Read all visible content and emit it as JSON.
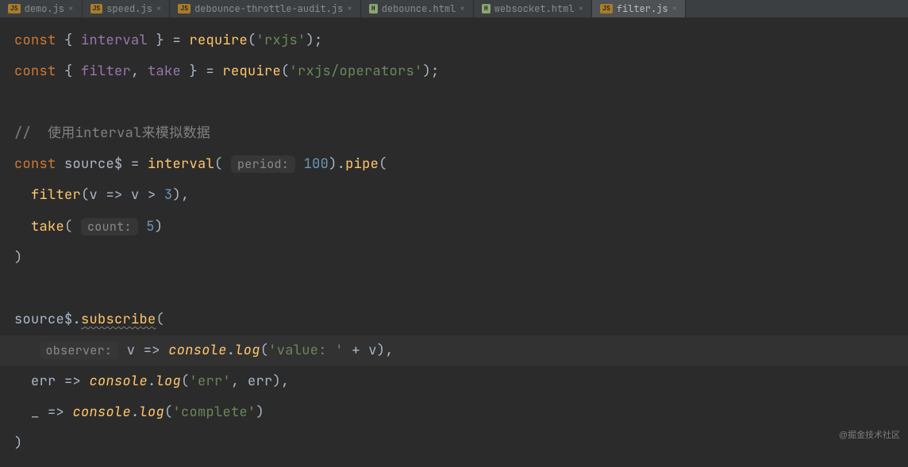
{
  "tabs": [
    {
      "type": "js",
      "label": "demo.js"
    },
    {
      "type": "js",
      "label": "speed.js"
    },
    {
      "type": "js",
      "label": "debounce-throttle-audit.js"
    },
    {
      "type": "html",
      "label": "debounce.html"
    },
    {
      "type": "html",
      "label": "websocket.html"
    },
    {
      "type": "js",
      "label": "filter.js",
      "active": true
    }
  ],
  "badges": {
    "js": "JS",
    "html": "H"
  },
  "watermark": "@掘金技术社区",
  "code": {
    "l1": {
      "kw_const": "const",
      "brace_o": "{ ",
      "id_interval": "interval",
      "brace_c": " } ",
      "eq": "= ",
      "req": "require",
      "paren": "(",
      "str": "'rxjs'",
      "end": ");"
    },
    "l2": {
      "kw_const": "const",
      "brace_o": "{ ",
      "id_filter": "filter",
      "comma": ", ",
      "id_take": "take",
      "brace_c": " } ",
      "eq": "= ",
      "req": "require",
      "paren": "(",
      "str": "'rxjs/operators'",
      "end": ");"
    },
    "l3": {
      "cmt": "//  使用interval来模拟数据"
    },
    "l4": {
      "kw_const": "const",
      "sp": " ",
      "id": "source$ ",
      "eq": "= ",
      "fn": "interval",
      "po": "( ",
      "hint": "period:",
      "num": " 100",
      "pc": ").",
      "pipe": "pipe",
      "po2": "("
    },
    "l5": {
      "indent": "  ",
      "fn": "filter",
      "po": "(",
      "v1": "v ",
      "arrow": "=> ",
      "v2": "v ",
      "gt": "> ",
      "num": "3",
      "pc": "),"
    },
    "l6": {
      "indent": "  ",
      "fn": "take",
      "po": "( ",
      "hint": "count:",
      "num": " 5",
      "pc": ")"
    },
    "l7": {
      "txt": ")"
    },
    "l8": {
      "id": "source$",
      "dot": ".",
      "fn": "subscribe",
      "po": "("
    },
    "l9": {
      "indent": "   ",
      "hint": "observer:",
      "sp": " ",
      "v": "v ",
      "arrow": "=> ",
      "console": "console",
      "dot": ".",
      "log": "log",
      "po": "(",
      "str": "'value: '",
      "plus": " + ",
      "v2": "v",
      "pc": "),"
    },
    "l10": {
      "indent": "  ",
      "err": "err ",
      "arrow": "=> ",
      "console": "console",
      "dot": ".",
      "log": "log",
      "po": "(",
      "str": "'err'",
      "comma": ", ",
      "err2": "err",
      "pc": "),"
    },
    "l11": {
      "indent": "  ",
      "us": "_ ",
      "arrow": "=> ",
      "console": "console",
      "dot": ".",
      "log": "log",
      "po": "(",
      "str": "'complete'",
      "pc": ")"
    },
    "l12": {
      "txt": ")"
    }
  }
}
